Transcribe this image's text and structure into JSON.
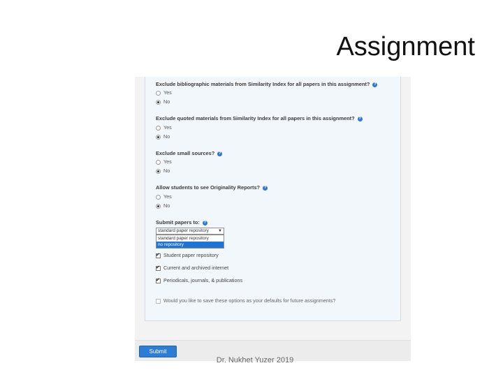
{
  "slide": {
    "title": "Assignment",
    "footer": "Dr. Nukhet Yuzer 2019"
  },
  "form": {
    "questions": [
      {
        "label": "Exclude bibliographic materials from Similarity Index for all papers in this assignment?",
        "options": [
          "Yes",
          "No"
        ],
        "selected": "No"
      },
      {
        "label": "Exclude quoted materials from Similarity Index for all papers in this assignment?",
        "options": [
          "Yes",
          "No"
        ],
        "selected": "No"
      },
      {
        "label": "Exclude small sources?",
        "options": [
          "Yes",
          "No"
        ],
        "selected": "No"
      },
      {
        "label": "Allow students to see Originality Reports?",
        "options": [
          "Yes",
          "No"
        ],
        "selected": "No"
      }
    ],
    "submit_papers": {
      "label": "Submit papers to:",
      "selected_value": "standard paper repository",
      "options": [
        "standard paper repository",
        "no repository"
      ],
      "highlighted": "no repository"
    },
    "checkboxes": [
      {
        "label": "Student paper repository",
        "checked": true
      },
      {
        "label": "Current and archived internet",
        "checked": true
      },
      {
        "label": "Periodicals, journals, & publications",
        "checked": true
      }
    ],
    "save_defaults": {
      "label": "Would you like to save these options as your defaults for future assignments?",
      "checked": false
    },
    "help_icon": "question-icon",
    "submit_label": "Submit"
  },
  "colors": {
    "accent": "#2d7dd6",
    "highlight": "#1e74d6",
    "panel": "#f2f7fc"
  }
}
